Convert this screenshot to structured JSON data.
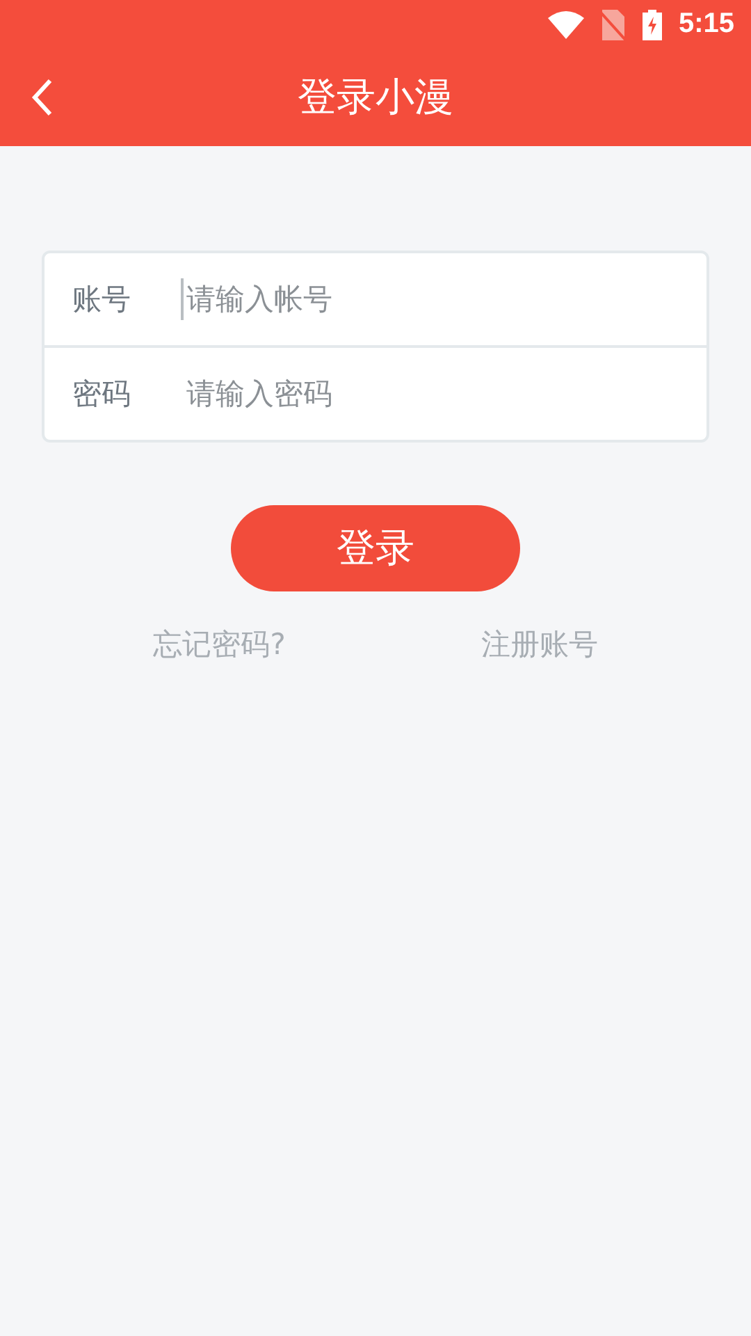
{
  "status_bar": {
    "time": "5:15"
  },
  "header": {
    "title": "登录小漫"
  },
  "form": {
    "fields": [
      {
        "label": "账号",
        "placeholder": "请输入帐号",
        "focused": true
      },
      {
        "label": "密码",
        "placeholder": "请输入密码",
        "focused": false
      }
    ]
  },
  "login_button": "登录",
  "links": [
    "忘记密码?",
    "注册账号"
  ]
}
